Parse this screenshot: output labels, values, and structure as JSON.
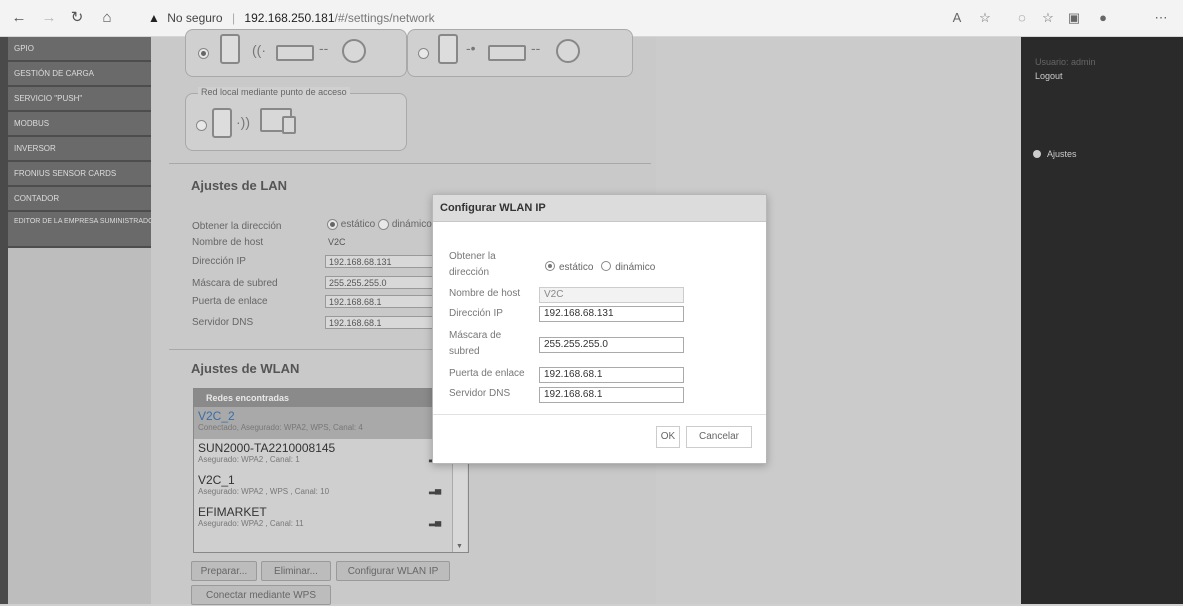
{
  "browser": {
    "security_label": "No seguro",
    "host": "192.168.250.181",
    "path": "/#/settings/network"
  },
  "sidebar": {
    "items": [
      {
        "label": "GPIO"
      },
      {
        "label": "GESTIÓN DE CARGA"
      },
      {
        "label": "SERVICIO \"PUSH\""
      },
      {
        "label": "MODBUS"
      },
      {
        "label": "INVERSOR"
      },
      {
        "label": "FRONIUS SENSOR CARDS"
      },
      {
        "label": "CONTADOR"
      },
      {
        "label": "EDITOR DE LA EMPRESA SUMINISTRADORA DE ENERGÍA"
      }
    ]
  },
  "right_panel": {
    "user": "Usuario: admin",
    "logout": "Logout",
    "settings": "Ajustes"
  },
  "modes": {
    "access_point_label": "Red local mediante punto de acceso"
  },
  "lan": {
    "title": "Ajustes de LAN",
    "obtain_label": "Obtener la dirección",
    "static_label": "estático",
    "dynamic_label": "dinámico",
    "hostname_label": "Nombre de host",
    "hostname": "V2C",
    "ip_label": "Dirección IP",
    "ip": "192.168.68.131",
    "mask_label": "Máscara de subred",
    "mask": "255.255.255.0",
    "gateway_label": "Puerta de enlace",
    "gateway": "192.168.68.1",
    "dns_label": "Servidor DNS",
    "dns": "192.168.68.1"
  },
  "wlan": {
    "title": "Ajustes de WLAN",
    "list_header": "Redes encontradas",
    "networks": [
      {
        "name": "V2C_2",
        "sub": "Conectado, Asegurado: WPA2, WPS, Canal: 4"
      },
      {
        "name": "SUN2000-TA2210008145",
        "sub": "Asegurado: WPA2 , Canal: 1"
      },
      {
        "name": "V2C_1",
        "sub": "Asegurado: WPA2 , WPS , Canal: 10"
      },
      {
        "name": "EFIMARKET",
        "sub": "Asegurado: WPA2 , Canal: 11"
      }
    ],
    "prepare_button": "Preparar...",
    "delete_button": "Eliminar...",
    "configure_button": "Configurar WLAN IP",
    "wps_button": "Conectar mediante WPS"
  },
  "modal": {
    "title": "Configurar WLAN IP",
    "obtain_label_1": "Obtener la",
    "obtain_label_2": "dirección",
    "static_label": "estático",
    "dynamic_label": "dinámico",
    "hostname_label": "Nombre de host",
    "hostname": "V2C",
    "ip_label": "Dirección IP",
    "ip": "192.168.68.131",
    "mask_label_1": "Máscara de",
    "mask_label_2": "subred",
    "mask": "255.255.255.0",
    "gateway_label": "Puerta de enlace",
    "gateway": "192.168.68.1",
    "dns_label": "Servidor DNS",
    "dns": "192.168.68.1",
    "ok_button": "OK",
    "cancel_button": "Cancelar"
  }
}
